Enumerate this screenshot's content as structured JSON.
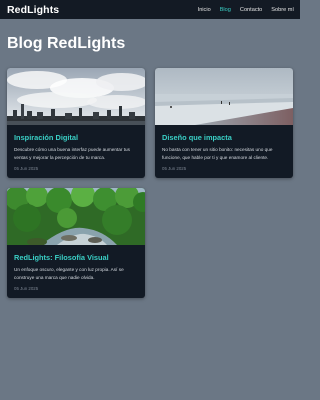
{
  "header": {
    "brand": "RedLights",
    "nav": [
      "Inicio",
      "Blog",
      "Contacto",
      "Sobre mí"
    ]
  },
  "page": {
    "title": "Blog RedLights"
  },
  "posts": [
    {
      "title": "Inspiración Digital",
      "excerpt": "Descubre cómo una buena interfaz puede aumentar tus ventas y mejorar la percepción de tu marca.",
      "date": "05 Jun 2025"
    },
    {
      "title": "Diseño que impacta",
      "excerpt": "No basta con tener un sitio bonito: necesitas uno que funcione, que hable por ti y que enamore al cliente.",
      "date": "05 Jun 2025"
    },
    {
      "title": "RedLights: Filosofía Visual",
      "excerpt": "Un enfoque oscuro, elegante y con luz propia. Así se construye una marca que nadie olvida.",
      "date": "05 Jun 2025"
    }
  ],
  "colors": {
    "background": "#6b7785",
    "header": "#131a24",
    "card": "#121a25",
    "accent": "#3ad0c6"
  }
}
